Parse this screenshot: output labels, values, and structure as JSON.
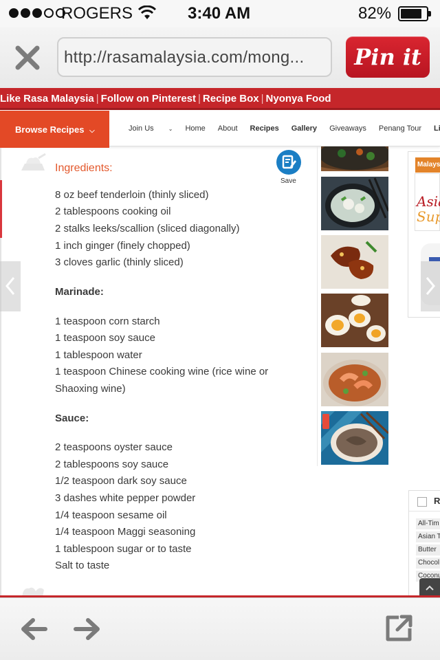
{
  "status": {
    "carrier": "ROGERS",
    "time": "3:40 AM",
    "battery": "82%"
  },
  "browser": {
    "url": "http://rasamalaysia.com/mong...",
    "pin_label": "Pin it"
  },
  "site": {
    "topbar_links": [
      "Like Rasa Malaysia",
      "Follow on Pinterest",
      "Recipe Box",
      "Nyonya Food"
    ],
    "browse_label": "Browse Recipes",
    "nav": [
      "Join Us",
      "Home",
      "About",
      "Recipes",
      "Gallery",
      "Giveaways",
      "Penang Tour",
      "Lik"
    ]
  },
  "recipe": {
    "ingredients_title": "Ingredients:",
    "save_label": "Save",
    "ingredients": [
      "8 oz beef tenderloin (thinly sliced)",
      "2 tablespoons cooking oil",
      "2 stalks leeks/scallion (sliced diagonally)",
      "1 inch ginger (finely chopped)",
      "3 cloves garlic (thinly sliced)"
    ],
    "marinade_title": "Marinade:",
    "marinade": [
      "1 teaspoon corn starch",
      "1 teaspoon soy sauce",
      "1 tablespoon water",
      "1 teaspoon Chinese cooking wine (rice wine or",
      "Shaoxing wine)"
    ],
    "sauce_title": "Sauce:",
    "sauce": [
      "2 teaspoons oyster sauce",
      "2 tablespoons soy sauce",
      "1/2 teaspoon dark soy sauce",
      "3 dashes white pepper powder",
      "1/4 teaspoon sesame oil",
      "1/4 teaspoon Maggi seasoning",
      "1 tablespoon sugar or to taste",
      "Salt to taste"
    ]
  },
  "ad": {
    "header": "Malaysi",
    "line1": "Asia",
    "line2": "Sup"
  },
  "widget": {
    "label": "R",
    "tags": [
      "All-Tim",
      "Asian T",
      "Butter",
      "Chocol",
      "Coconu"
    ]
  },
  "colors": {
    "brand_red": "#c5262a",
    "browse_orange": "#e34926",
    "ingredients_orange": "#e3582c",
    "pin_red": "#cc1f2b"
  }
}
